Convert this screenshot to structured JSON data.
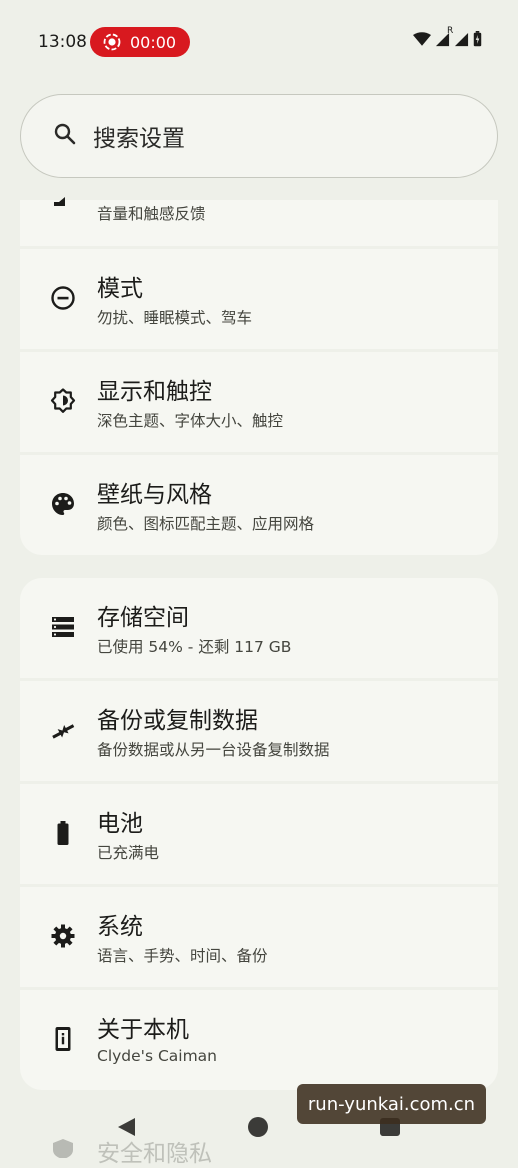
{
  "status_bar": {
    "time": "13:08",
    "recording_time": "00:00",
    "icons": [
      "screen-record-icon",
      "wifi-icon",
      "cell-signal-icon",
      "roaming-signal-icon",
      "battery-icon"
    ],
    "roaming_letter": "R",
    "record_color": "#d8191f"
  },
  "search": {
    "placeholder": "搜索设置",
    "icon": "search-icon"
  },
  "groups": [
    {
      "items": [
        {
          "title": "",
          "subtitle": "音量和触感反馈",
          "icon": "sound-icon"
        },
        {
          "title": "模式",
          "subtitle": "勿扰、睡眠模式、驾车",
          "icon": "modes-icon"
        },
        {
          "title": "显示和触控",
          "subtitle": "深色主题、字体大小、触控",
          "icon": "display-brightness-icon"
        },
        {
          "title": "壁纸与风格",
          "subtitle": "颜色、图标匹配主题、应用网格",
          "icon": "palette-icon"
        }
      ]
    },
    {
      "items": [
        {
          "title": "存储空间",
          "subtitle": "已使用 54% - 还剩 117 GB",
          "icon": "storage-icon"
        },
        {
          "title": "备份或复制数据",
          "subtitle": "备份数据或从另一台设备复制数据",
          "icon": "backup-transfer-icon"
        },
        {
          "title": "电池",
          "subtitle": "已充满电",
          "icon": "battery-full-icon"
        },
        {
          "title": "系统",
          "subtitle": "语言、手势、时间、备份",
          "icon": "gear-icon"
        },
        {
          "title": "关于本机",
          "subtitle": "Clyde's Caiman",
          "icon": "about-phone-icon"
        }
      ]
    }
  ],
  "next_item_partial": {
    "title": "安全和隐私",
    "icon": "security-icon"
  },
  "navigation": {
    "icons": [
      "back-icon",
      "home-icon",
      "recents-icon"
    ]
  },
  "watermark": "run-yunkai.com.cn"
}
